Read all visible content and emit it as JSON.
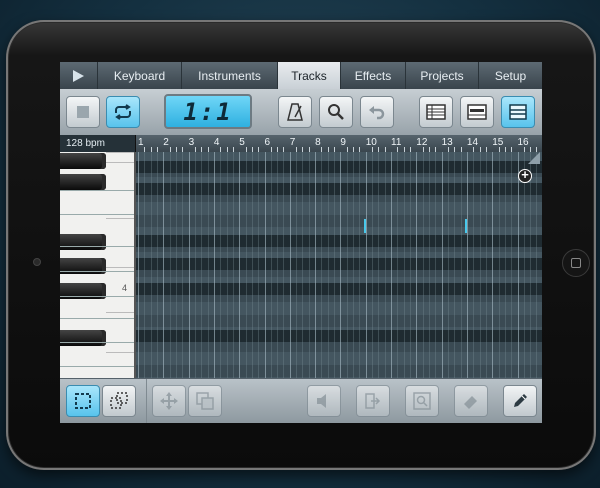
{
  "tabs": {
    "play_icon": "play-icon",
    "items": [
      {
        "label": "Keyboard",
        "active": false
      },
      {
        "label": "Instruments",
        "active": false
      },
      {
        "label": "Tracks",
        "active": true
      },
      {
        "label": "Effects",
        "active": false
      },
      {
        "label": "Projects",
        "active": false
      },
      {
        "label": "Setup",
        "active": false
      }
    ]
  },
  "toolbar": {
    "position_display": "1:1",
    "icons": [
      "stop-icon",
      "loop-icon",
      "metronome-icon",
      "search-icon",
      "undo-icon",
      "list-view-icon",
      "track-view-icon",
      "mixer-view-icon"
    ]
  },
  "timeline": {
    "tempo": "128 bpm",
    "bars": [
      "1",
      "2",
      "3",
      "4",
      "5",
      "6",
      "7",
      "8",
      "9",
      "10",
      "11",
      "12",
      "13",
      "14",
      "15",
      "16"
    ]
  },
  "piano": {
    "octave_label": "4"
  },
  "bottom_toolbar": {
    "icons": [
      "select-rect-icon",
      "select-lasso-icon",
      "move-icon",
      "copy-icon",
      "volume-icon",
      "export-icon",
      "zoom-fit-icon",
      "eraser-icon",
      "pencil-icon"
    ]
  },
  "colors": {
    "accent": "#58c3ec",
    "grid_bg": "#3a4a53",
    "note": "#49c9ec"
  }
}
